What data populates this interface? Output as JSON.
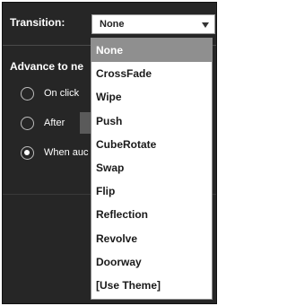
{
  "transition": {
    "label": "Transition:",
    "selected_value": "None"
  },
  "advance": {
    "heading": "Advance to ne",
    "options": [
      {
        "label": "On click",
        "checked": false
      },
      {
        "label": "After",
        "checked": false
      },
      {
        "label": "When auc",
        "checked": true
      }
    ]
  },
  "dropdown": {
    "items": [
      "None",
      "CrossFade",
      "Wipe",
      "Push",
      "CubeRotate",
      "Swap",
      "Flip",
      "Reflection",
      "Revolve",
      "Doorway",
      "[Use Theme]"
    ],
    "selected_index": 0
  }
}
